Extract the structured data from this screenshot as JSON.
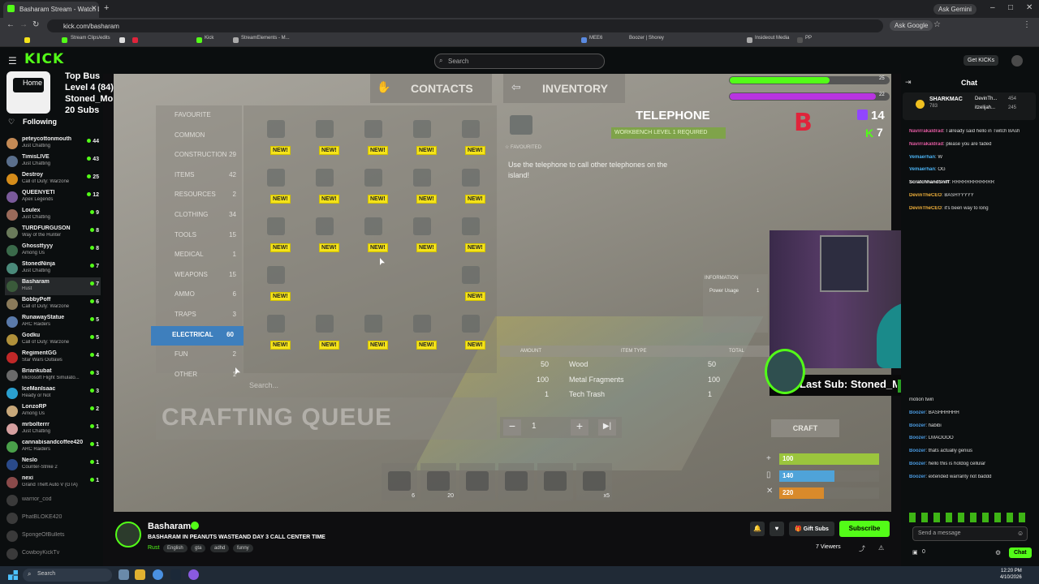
{
  "browser": {
    "tab_title": "Basharam Stream - Watch Live...",
    "ask_gemini": "Ask Gemini",
    "url": "kick.com/basharam",
    "ask_google": "Ask Google",
    "bookmarks": [
      "Stream Clips/edits",
      "Kick",
      "StreamElements - M...",
      "MEE6",
      "Boozer | Shorey",
      "Insideout Media",
      "PP"
    ]
  },
  "kick": {
    "logo": "KICK",
    "search_placeholder": "Search",
    "get_kicks": "Get KICKs",
    "home": "Home",
    "top_bus": [
      "Top Bus",
      "Level 4  (84)",
      "Stoned_Mopar x6",
      "20 Subs"
    ],
    "following": "Following"
  },
  "sidebar": [
    {
      "name": "peteycottonmouth",
      "game": "Just Chatting",
      "viewers": "44",
      "color": "#c48a55"
    },
    {
      "name": "TimisLIVE",
      "game": "Just Chatting",
      "viewers": "43",
      "color": "#5a6f8c"
    },
    {
      "name": "Destroy",
      "game": "Call of Duty: Warzone",
      "viewers": "25",
      "color": "#d58c1a"
    },
    {
      "name": "QUEENYETI",
      "game": "Apex Legends",
      "viewers": "12",
      "color": "#7a5a9a"
    },
    {
      "name": "Loulex",
      "game": "Just Chatting",
      "viewers": "9",
      "color": "#9a6a5a"
    },
    {
      "name": "TURDFURGUSON",
      "game": "Way of the Hunter",
      "viewers": "8",
      "color": "#6a7a5a"
    },
    {
      "name": "Ghossttyyy",
      "game": "Among Us",
      "viewers": "8",
      "color": "#3a6a4a"
    },
    {
      "name": "StonedNinja",
      "game": "Just Chatting",
      "viewers": "7",
      "color": "#4a8a7a"
    },
    {
      "name": "Basharam",
      "game": "Rust",
      "viewers": "7",
      "color": "#3a5a3a"
    },
    {
      "name": "BobbyPoff",
      "game": "Call of Duty: Warzone",
      "viewers": "6",
      "color": "#8a7a5a"
    },
    {
      "name": "RunawayStatue",
      "game": "ARC Raiders",
      "viewers": "5",
      "color": "#5a7aaa"
    },
    {
      "name": "Godku",
      "game": "Call of Duty: Warzone",
      "viewers": "5",
      "color": "#b0903a"
    },
    {
      "name": "RegimentGG",
      "game": "Star Wars Outlaws",
      "viewers": "4",
      "color": "#c02828"
    },
    {
      "name": "Briankubat",
      "game": "Microsoft Flight Simulato...",
      "viewers": "3",
      "color": "#6a6a6a"
    },
    {
      "name": "IceManIsaac",
      "game": "Ready or Not",
      "viewers": "3",
      "color": "#2aa0d0"
    },
    {
      "name": "LonzoRP",
      "game": "Among Us",
      "viewers": "2",
      "color": "#c8a87a"
    },
    {
      "name": "mrbolterrr",
      "game": "Just Chatting",
      "viewers": "1",
      "color": "#d6a0a0"
    },
    {
      "name": "cannabisandcoffee420",
      "game": "ARC Raiders",
      "viewers": "1",
      "color": "#4aa04a"
    },
    {
      "name": "Neslo",
      "game": "Counter-Strike 2",
      "viewers": "1",
      "color": "#2a4a8a"
    },
    {
      "name": "nexi",
      "game": "Grand Theft Auto V (GTA)",
      "viewers": "1",
      "color": "#8a4a4a"
    }
  ],
  "sidebar_offline": [
    "warrior_cod",
    "PhatBLOKE420",
    "SpongeOfBullets",
    "CowboyKickTv"
  ],
  "game": {
    "tab_contacts": "CONTACTS",
    "tab_inventory": "INVENTORY",
    "categories": [
      {
        "label": "FAVOURITE",
        "count": ""
      },
      {
        "label": "COMMON",
        "count": ""
      },
      {
        "label": "CONSTRUCTION",
        "count": "29"
      },
      {
        "label": "ITEMS",
        "count": "42"
      },
      {
        "label": "RESOURCES",
        "count": "2"
      },
      {
        "label": "CLOTHING",
        "count": "34"
      },
      {
        "label": "TOOLS",
        "count": "15"
      },
      {
        "label": "MEDICAL",
        "count": "1"
      },
      {
        "label": "WEAPONS",
        "count": "15"
      },
      {
        "label": "AMMO",
        "count": "6"
      },
      {
        "label": "TRAPS",
        "count": "3"
      },
      {
        "label": "ELECTRICAL",
        "count": "60"
      },
      {
        "label": "FUN",
        "count": "2"
      },
      {
        "label": "OTHER",
        "count": "1"
      }
    ],
    "new_badge": "NEW!",
    "search": "Search...",
    "crafting_queue": "CRAFTING QUEUE",
    "item_title": "TELEPHONE",
    "workbench": "WORKBENCH LEVEL 1 REQUIRED",
    "favourited": "FAVOURITED",
    "description": "Use the telephone to call other telephones on the island!",
    "info_title": "INFORMATION",
    "power_label": "Power Usage",
    "power_value": "1",
    "cost_headers": [
      "AMOUNT",
      "ITEM TYPE",
      "TOTAL"
    ],
    "cost_rows": [
      {
        "amount": "50",
        "item": "Wood",
        "total": "50"
      },
      {
        "amount": "100",
        "item": "Metal Fragments",
        "total": "100"
      },
      {
        "amount": "1",
        "item": "Tech Trash",
        "total": "1"
      }
    ],
    "qty": "1",
    "craft": "CRAFT",
    "vitals": [
      {
        "value": "100",
        "color": "#9bc53d",
        "fill": 1.0
      },
      {
        "value": "140",
        "color": "#4fa3d9",
        "fill": 0.55
      },
      {
        "value": "220",
        "color": "#d98a2b",
        "fill": 0.45
      }
    ],
    "hotbar_counts": [
      "6",
      "20",
      "",
      "",
      "",
      "x5"
    ],
    "count_twitch": "14",
    "count_kick": "7",
    "goal_top": "25",
    "goal_bottom": "22"
  },
  "overlay": {
    "sub_banner": "Last Sub: Stoned_Mopar",
    "sub_count": "24"
  },
  "chat": {
    "title": "Chat",
    "pinned": [
      {
        "name": "SHARKMAC",
        "count": "783"
      },
      {
        "name": "DevinTh...",
        "count": "454"
      },
      {
        "name": "itzelijah...",
        "count": "245"
      }
    ],
    "messages_top": [
      {
        "user": "Navirrakaldrad",
        "color": "#e05aa0",
        "text": "I already said hello in Twitch BAsh"
      },
      {
        "user": "Navirrakaldrad",
        "color": "#e05aa0",
        "text": "please you are faded"
      },
      {
        "user": "Vemaerhan",
        "color": "#4ab0f0",
        "text": "W"
      },
      {
        "user": "Vemaerhan",
        "color": "#4ab0f0",
        "text": "OG"
      },
      {
        "user": "ScratchhandSniff",
        "color": "#ffffff",
        "text": "RRRRRRRRRRRR"
      },
      {
        "user": "DevinTheCEO",
        "color": "#f0b03a",
        "text": "BASHYYYYY"
      },
      {
        "user": "DevinTheCEO",
        "color": "#f0b03a",
        "text": "it's been way to long"
      }
    ],
    "messages_bottom": [
      {
        "user": "",
        "color": "#ffffff",
        "text": "motion twin"
      },
      {
        "user": "Boozer",
        "color": "#4a9ae0",
        "text": "BASHHHHHH"
      },
      {
        "user": "Boozer",
        "color": "#4a9ae0",
        "text": "habibi"
      },
      {
        "user": "Boozer",
        "color": "#4a9ae0",
        "text": "LMAOOOO"
      },
      {
        "user": "Boozer",
        "color": "#4a9ae0",
        "text": "thats actually genius"
      },
      {
        "user": "Boozer",
        "color": "#4a9ae0",
        "text": "hello this is hotdog cellular"
      },
      {
        "user": "Boozer",
        "color": "#4a9ae0",
        "text": "extended warranty not baddd"
      }
    ],
    "send_placeholder": "Send a message",
    "kicks": "0",
    "chat_button": "Chat"
  },
  "channel": {
    "name": "Basharam",
    "title": "BASHARAM IN PEANUTS WASTEAND  DAY 3  CALL CENTER TIME",
    "game": "Rust",
    "tags": [
      "English",
      "gta",
      "adhd",
      "funny"
    ],
    "gift_subs": "Gift Subs",
    "subscribe": "Subscribe",
    "viewers": "7 Viewers"
  },
  "taskbar": {
    "search": "Search",
    "time": "12:20 PM",
    "date": "4/10/2026"
  }
}
